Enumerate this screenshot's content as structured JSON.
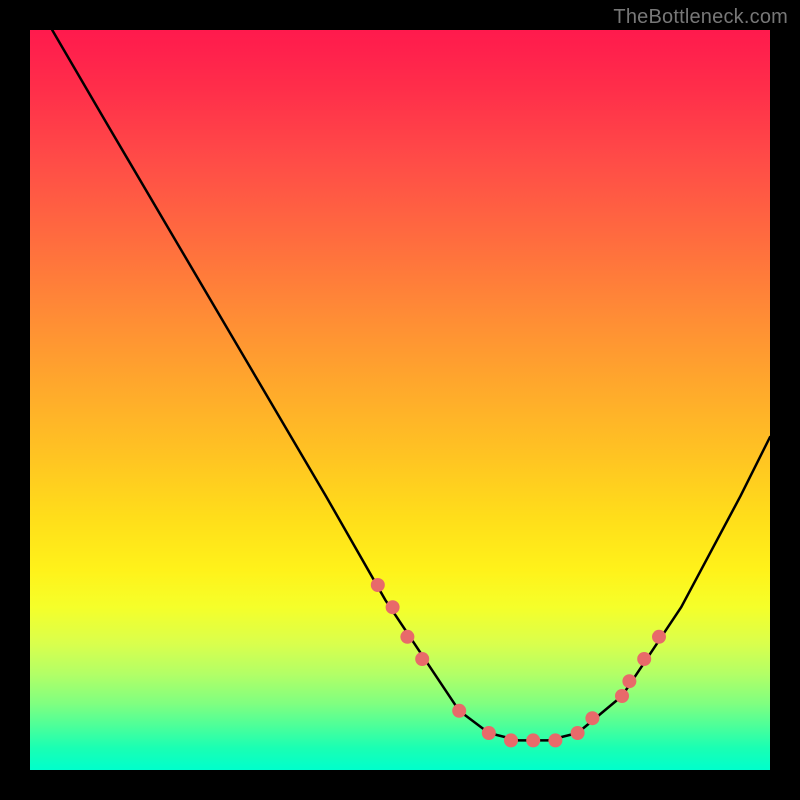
{
  "watermark": "TheBottleneck.com",
  "chart_data": {
    "type": "line",
    "title": "",
    "xlabel": "",
    "ylabel": "",
    "xlim": [
      0,
      100
    ],
    "ylim": [
      0,
      100
    ],
    "grid": false,
    "legend": false,
    "series": [
      {
        "name": "curve",
        "x": [
          3,
          10,
          20,
          30,
          40,
          48,
          54,
          58,
          62,
          66,
          70,
          74,
          80,
          88,
          96,
          100
        ],
        "y": [
          100,
          88,
          71,
          54,
          37,
          23,
          14,
          8,
          5,
          4,
          4,
          5,
          10,
          22,
          37,
          45
        ]
      }
    ],
    "markers": {
      "name": "dots",
      "color": "#e86a6a",
      "radius": 7,
      "x": [
        47,
        49,
        51,
        53,
        58,
        62,
        65,
        68,
        71,
        74,
        76,
        80,
        81,
        83,
        85
      ],
      "y": [
        25,
        22,
        18,
        15,
        8,
        5,
        4,
        4,
        4,
        5,
        7,
        10,
        12,
        15,
        18
      ]
    },
    "colors": {
      "line": "#000000",
      "marker": "#e86a6a",
      "gradient_top": "#ff1a4d",
      "gradient_bottom": "#00ffcc"
    }
  }
}
